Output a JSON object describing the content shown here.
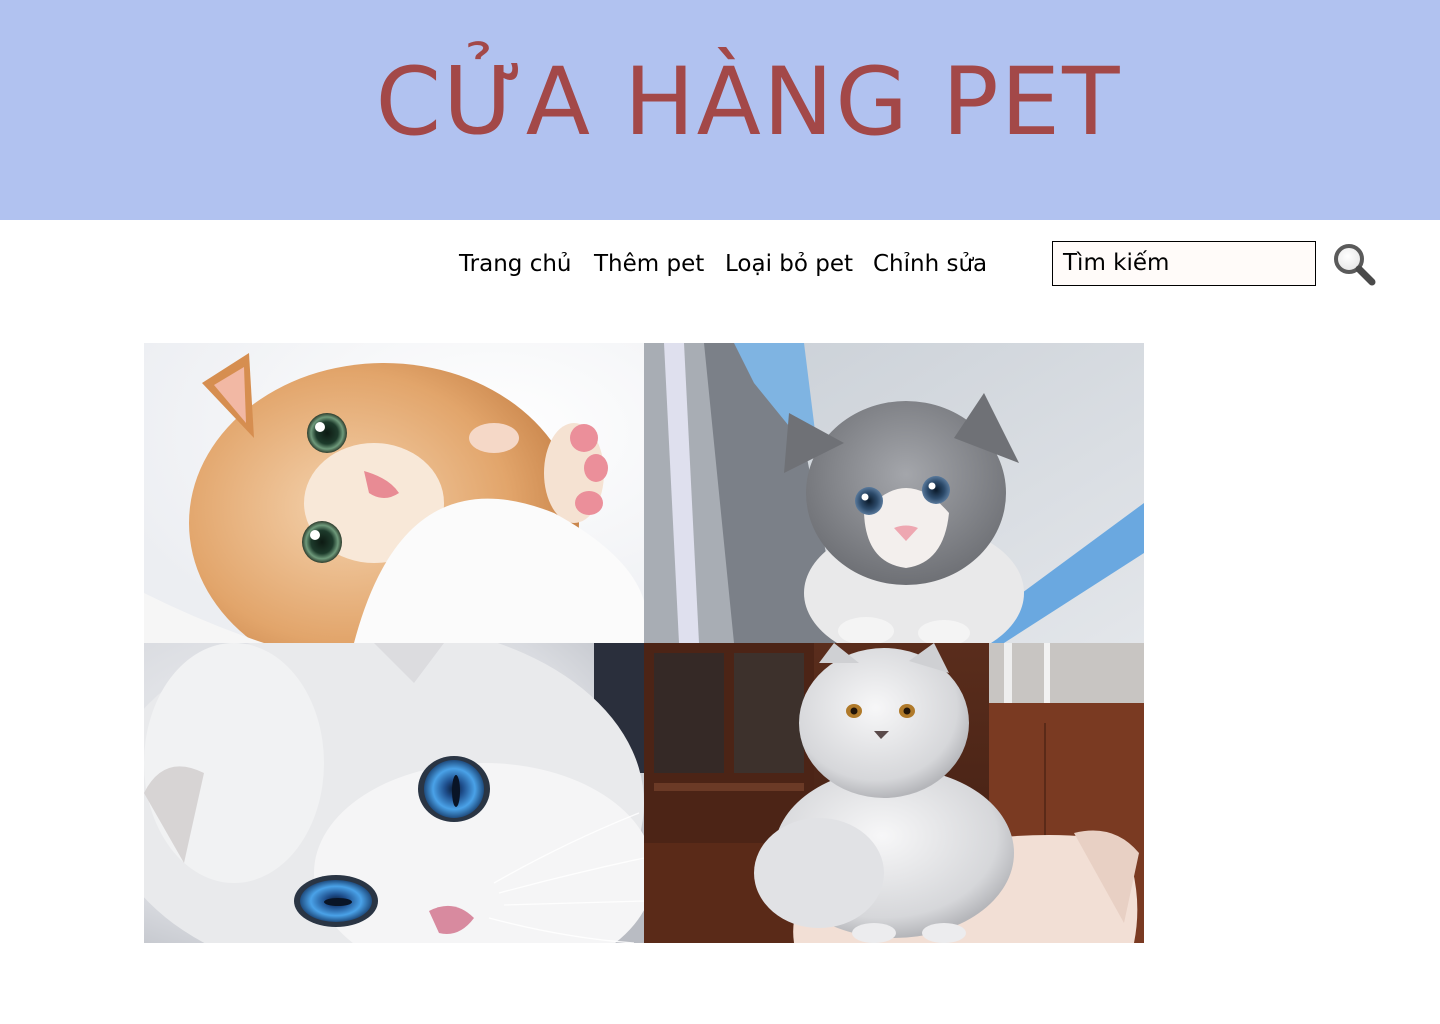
{
  "header": {
    "title": "CỬA HÀNG PET"
  },
  "nav": {
    "items": [
      {
        "label": "Trang chủ"
      },
      {
        "label": "Thêm pet"
      },
      {
        "label": "Loại bỏ pet"
      },
      {
        "label": "Chỉnh sửa"
      }
    ]
  },
  "search": {
    "placeholder": "Tìm kiếm",
    "icon": "search-icon"
  },
  "gallery": {
    "images": [
      {
        "subject": "orange-white-kitten"
      },
      {
        "subject": "gray-white-kitten"
      },
      {
        "subject": "white-blue-eyed-cat"
      },
      {
        "subject": "white-persian-cat"
      }
    ]
  },
  "colors": {
    "banner_bg": "#b1c2f0",
    "title_color": "#a34848",
    "search_bg": "#fffbf9"
  }
}
